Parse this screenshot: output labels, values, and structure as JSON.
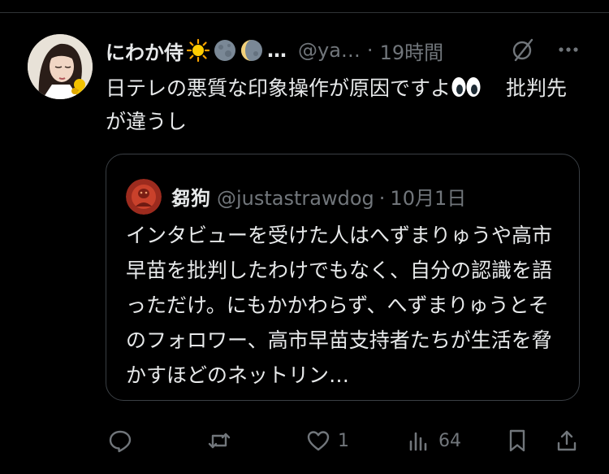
{
  "tweet": {
    "display_name": "にわか侍",
    "name_emojis": [
      "sun-emoji",
      "new-moon-emoji",
      "waxing-crescent-emoji"
    ],
    "name_overflow": "…",
    "handle": "@ya…",
    "time": "19時間",
    "text_main": "日テレの悪質な印象操作が原因ですよ",
    "text_emoji": "eyes-emoji",
    "text_rest": "批判先が違うし"
  },
  "quote": {
    "display_name": "芻狗",
    "handle": "@justastrawdog",
    "time": "10月1日",
    "text": "インタビューを受けた人はへずまりゅうや高市早苗を批判したわけでもなく、自分の認識を語っただけ。にもかかわらず、へずまりゅうとそのフォロワー、高市早苗支持者たちが生活を脅かすほどのネットリン…"
  },
  "actions": {
    "reply_count": "",
    "repost_count": "",
    "like_count": "1",
    "views_count": "64"
  },
  "colors": {
    "background": "#000000",
    "text": "#e7e9ea",
    "secondary": "#71767b",
    "border": "#3a3f44"
  },
  "separators": {
    "dot": "·"
  }
}
